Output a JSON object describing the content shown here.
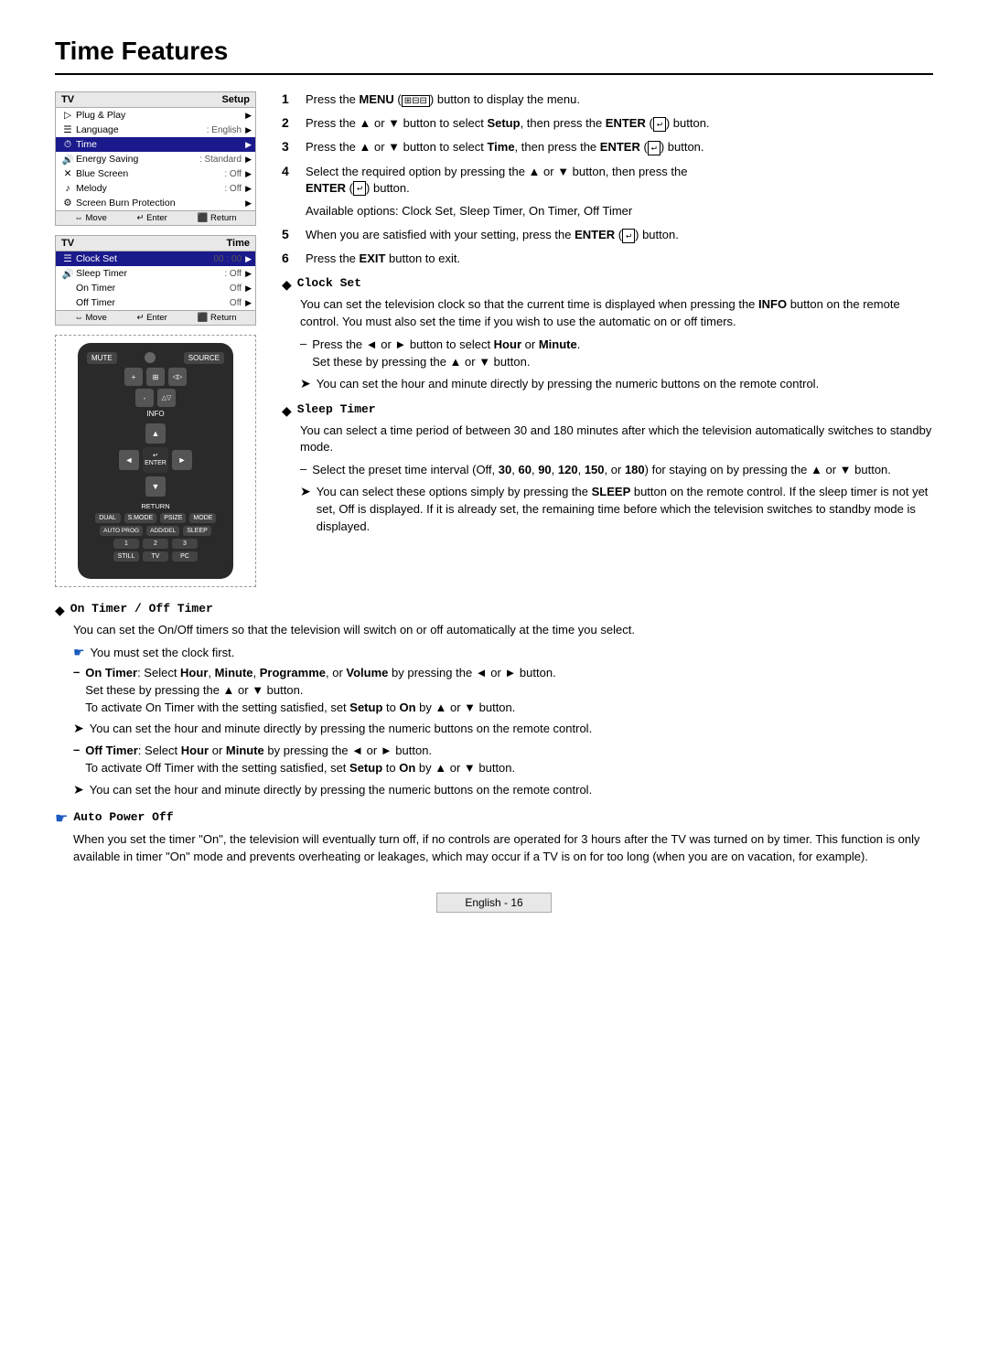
{
  "page": {
    "title": "Time Features",
    "footer": "English - 16"
  },
  "menu1": {
    "left_header": "TV",
    "right_header": "Setup",
    "rows": [
      {
        "icon": "▶",
        "label": "Plug & Play",
        "value": "",
        "arrow": "▶",
        "highlight": false
      },
      {
        "icon": "☰",
        "label": "Language",
        "value": ": English",
        "arrow": "▶",
        "highlight": false
      },
      {
        "icon": "♪",
        "label": "Time",
        "value": "",
        "arrow": "▶",
        "highlight": true
      },
      {
        "icon": "✕",
        "label": "Energy Saving",
        "value": ": Standard",
        "arrow": "▶",
        "highlight": false
      },
      {
        "icon": "🔊",
        "label": "Blue Screen",
        "value": ": Off",
        "arrow": "▶",
        "highlight": false
      },
      {
        "icon": "",
        "label": "Melody",
        "value": ": Off",
        "arrow": "▶",
        "highlight": false
      },
      {
        "icon": "⚙",
        "label": "Screen Burn Protection",
        "value": "",
        "arrow": "▶",
        "highlight": false
      }
    ],
    "footer": [
      "⇔ Move",
      "↵ Enter",
      "⬛ Return"
    ]
  },
  "menu2": {
    "left_header": "TV",
    "right_header": "Time",
    "rows": [
      {
        "icon": "☰",
        "label": "Clock Set",
        "value": "00 : 00",
        "arrow": "▶",
        "highlight": true
      },
      {
        "icon": "🔊",
        "label": "Sleep Timer",
        "value": ": Off",
        "arrow": "▶",
        "highlight": false
      },
      {
        "icon": "",
        "label": "On Timer",
        "value": "Off",
        "arrow": "▶",
        "highlight": false
      },
      {
        "icon": "",
        "label": "Off Timer",
        "value": "Off",
        "arrow": "▶",
        "highlight": false
      }
    ],
    "footer": [
      "⇔ Move",
      "↵ Enter",
      "⬛ Return"
    ]
  },
  "steps": [
    {
      "num": "1",
      "text": "Press the ",
      "bold": "MENU",
      "icon": "⊞",
      "suffix": " button to display the menu."
    },
    {
      "num": "2",
      "text": "Press the ▲ or ▼ button to select ",
      "bold": "Setup",
      "suffix": ", then press the ",
      "bold2": "ENTER",
      "icon2": "↵",
      "suffix2": " button."
    },
    {
      "num": "3",
      "text": "Press the ▲ or ▼ button to select ",
      "bold3": "Time",
      "suffix3": ", then press the ",
      "bold4": "ENTER",
      "icon3": "↵",
      "suffix4": " button."
    },
    {
      "num": "4",
      "text": "Select the required option by pressing the ▲ or ▼ button, then press the ",
      "bold5": "ENTER",
      "icon4": "↵",
      "suffix5": " button."
    },
    {
      "num": "5",
      "text": "When you are satisfied with your setting, press the ",
      "bold6": "ENTER",
      "icon5": "↵",
      "suffix6": " button."
    },
    {
      "num": "6",
      "text": "Press the ",
      "bold7": "EXIT",
      "suffix7": " button to exit."
    }
  ],
  "available_options": "Available options: Clock Set, Sleep Timer, On Timer, Off Timer",
  "sections": {
    "clock_set": {
      "title": "Clock Set",
      "body": "You can set the television clock so that the current time is displayed when pressing the INFO button on the remote control. You must also set the time if you wish to use the automatic on or off timers.",
      "dash1": "Press the ◄ or ► button to select Hour or Minute. Set these by pressing the ▲ or ▼ button.",
      "arrow1": "You can set the hour and minute directly by pressing the numeric buttons on the remote control."
    },
    "sleep_timer": {
      "title": "Sleep Timer",
      "body": "You can select a time period of between 30 and 180 minutes after which the television automatically switches to standby mode.",
      "dash1": "Select the preset time interval (Off, 30, 60, 90, 120, 150, or 180) for staying on by pressing the ▲ or ▼ button.",
      "arrow1": "You can select these options simply by pressing the SLEEP button on the remote control. If the sleep timer is not yet set, Off is displayed. If it is already set, the remaining time before which the television switches to standby mode is displayed."
    },
    "on_off_timer": {
      "title": "On Timer / Off Timer",
      "body": "You can set the On/Off timers so that the television will switch on or off automatically at the time you select.",
      "note": "You must set the clock first.",
      "on_timer_label": "On Timer",
      "on_timer_body": "Select Hour, Minute, Programme, or Volume by pressing the ◄ or ► button. Set these by pressing the ▲ or ▼ button. To activate On Timer with the setting satisfied, set Setup to On by ▲ or ▼ button.",
      "on_arrow": "You can set the hour and minute directly by pressing the numeric buttons on the remote control.",
      "off_timer_label": "Off Timer",
      "off_timer_body": "Select Hour or Minute by pressing the ◄ or ► button. To activate Off Timer with the setting satisfied, set Setup to On by ▲ or ▼ button.",
      "off_arrow": "You can set the hour and minute directly by pressing the numeric buttons on the remote control."
    },
    "auto_power_off": {
      "title": "Auto Power Off",
      "body": "When you set the timer \"On\", the television will eventually turn off, if no controls are operated for 3 hours after the TV was turned on by timer. This function is only available in timer \"On\" mode and prevents overheating or leakages, which may occur if a TV is on for too long (when you are on vacation, for example)."
    }
  },
  "remote": {
    "buttons": {
      "mute": "MUTE",
      "source": "SOURCE",
      "info": "INFO",
      "menu": "MENU",
      "enter": "ENTER",
      "return": "RETURN",
      "dual": "DUAL",
      "smode": "S.MODE",
      "psize": "PSIZE",
      "mode": "MODE",
      "sleep": "SLEEP",
      "still": "STILL",
      "tv": "TV",
      "pc": "PC"
    }
  }
}
